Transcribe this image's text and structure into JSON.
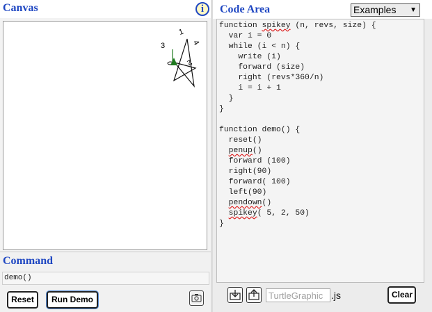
{
  "canvas": {
    "title": "Canvas",
    "info_icon": "info-icon",
    "drawing_labels": [
      "1",
      "3",
      "4",
      "2"
    ]
  },
  "command": {
    "title": "Command",
    "value": "demo()"
  },
  "buttons": {
    "reset": "Reset",
    "run_demo": "Run Demo",
    "clear": "Clear",
    "screenshot_icon": "camera-icon",
    "download_icon": "download-icon",
    "upload_icon": "upload-icon"
  },
  "code_area": {
    "title": "Code Area",
    "examples_select": "Examples",
    "lines": [
      "function spikey (n, revs, size) {",
      "  var i = 0",
      "  while (i < n) {",
      "    write (i)",
      "    forward (size)",
      "    right (revs*360/n)",
      "    i = i + 1",
      "  }",
      "}",
      "",
      "function demo() {",
      "  reset()",
      "  penup()",
      "  forward (100)",
      "  right(90)",
      "  forward( 100)",
      "  left(90)",
      "  pendown()",
      "  spikey( 5, 2, 50)",
      "}"
    ]
  },
  "file": {
    "placeholder": "TurtleGraphic",
    "extension": ".js"
  },
  "colors": {
    "title_blue": "#1f47c2",
    "turtle_green": "#1f7a1f",
    "error_squiggle": "#dd2222"
  }
}
